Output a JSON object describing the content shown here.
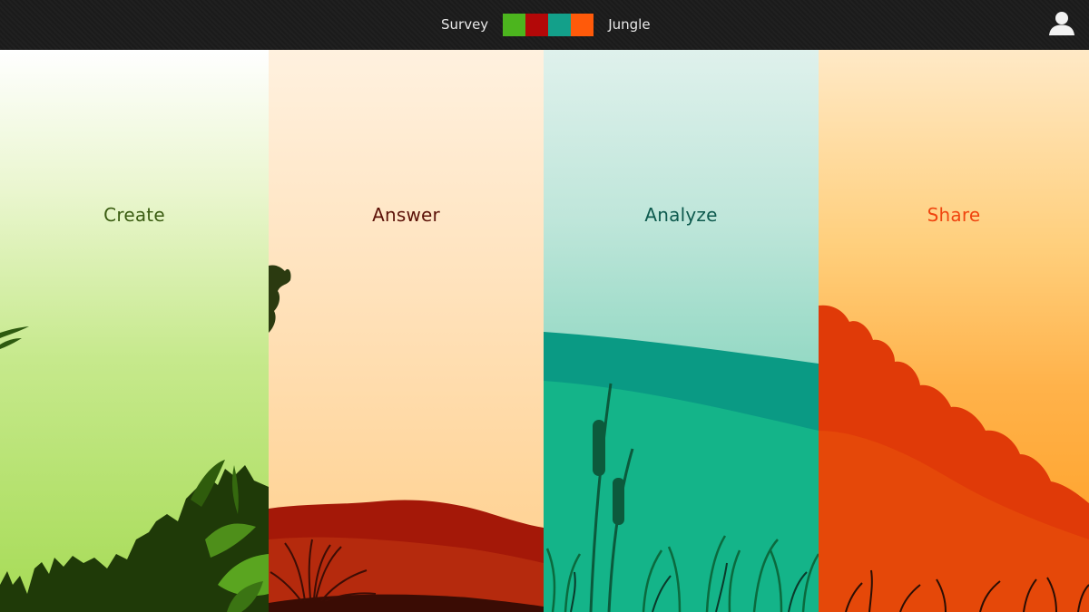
{
  "header": {
    "brand_left": "Survey",
    "brand_right": "Jungle",
    "swatches": [
      {
        "name": "green",
        "color": "#4cb51e"
      },
      {
        "name": "red",
        "color": "#b30808"
      },
      {
        "name": "teal",
        "color": "#13a08a"
      },
      {
        "name": "orange",
        "color": "#ff5a0a"
      }
    ],
    "user_icon": "user-icon"
  },
  "panels": [
    {
      "id": "create",
      "label": "Create",
      "label_color": "#3b5d12"
    },
    {
      "id": "answer",
      "label": "Answer",
      "label_color": "#5c1208"
    },
    {
      "id": "analyze",
      "label": "Analyze",
      "label_color": "#0e5a4e"
    },
    {
      "id": "share",
      "label": "Share",
      "label_color": "#f0450f"
    }
  ]
}
